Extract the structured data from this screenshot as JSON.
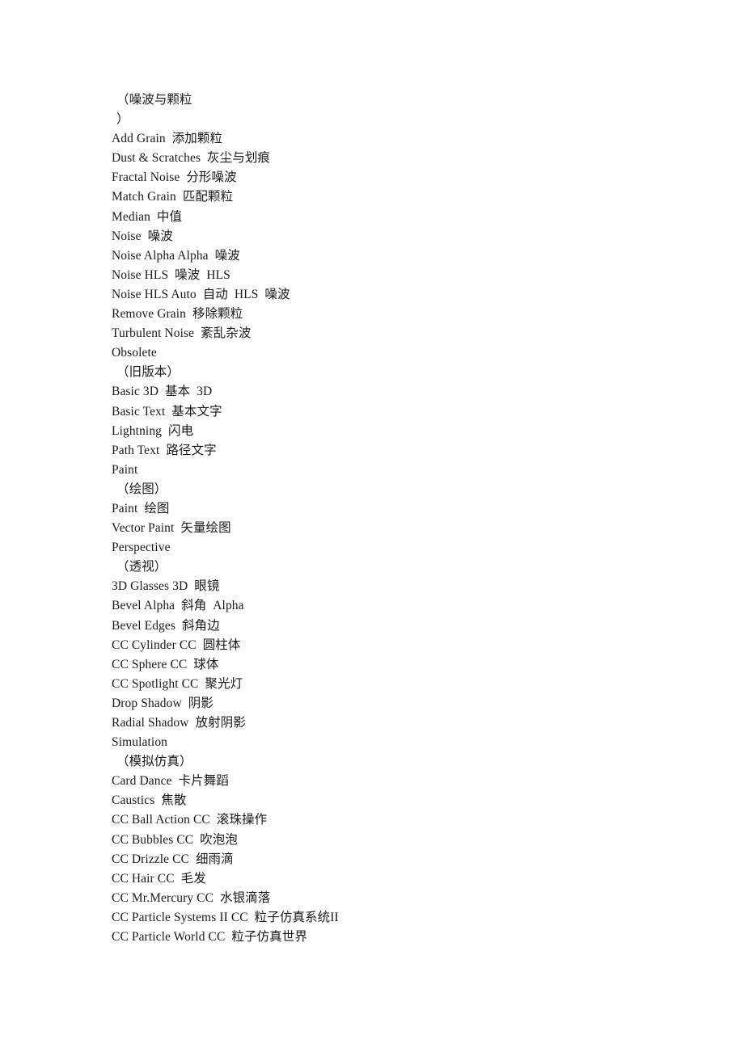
{
  "document": {
    "kind": "bilingual-reference-list",
    "description": "After Effects effect names with Chinese translations",
    "lines": [
      {
        "text": "（噪波与颗粒",
        "style": "indent"
      },
      {
        "text": "）",
        "style": "indent"
      },
      {
        "text": "Add Grain  添加颗粒",
        "style": "entry"
      },
      {
        "text": "Dust & Scratches  灰尘与划痕",
        "style": "entry"
      },
      {
        "text": "Fractal Noise  分形噪波",
        "style": "entry"
      },
      {
        "text": "Match Grain  匹配颗粒",
        "style": "entry"
      },
      {
        "text": "Median  中值",
        "style": "entry"
      },
      {
        "text": "Noise  噪波",
        "style": "entry"
      },
      {
        "text": "Noise Alpha Alpha  噪波",
        "style": "entry"
      },
      {
        "text": "Noise HLS  噪波  HLS",
        "style": "entry"
      },
      {
        "text": "Noise HLS Auto  自动  HLS  噪波",
        "style": "entry"
      },
      {
        "text": "Remove Grain  移除颗粒",
        "style": "entry"
      },
      {
        "text": "Turbulent Noise  紊乱杂波",
        "style": "entry"
      },
      {
        "text": "Obsolete",
        "style": "entry"
      },
      {
        "text": "（旧版本）",
        "style": "indent"
      },
      {
        "text": "Basic 3D  基本  3D",
        "style": "entry"
      },
      {
        "text": "Basic Text  基本文字",
        "style": "entry"
      },
      {
        "text": "Lightning  闪电",
        "style": "entry"
      },
      {
        "text": "Path Text  路径文字",
        "style": "entry"
      },
      {
        "text": "Paint",
        "style": "entry"
      },
      {
        "text": "（绘图）",
        "style": "indent"
      },
      {
        "text": "Paint  绘图",
        "style": "entry"
      },
      {
        "text": "Vector Paint  矢量绘图",
        "style": "entry"
      },
      {
        "text": "Perspective",
        "style": "entry"
      },
      {
        "text": "（透视）",
        "style": "indent"
      },
      {
        "text": "3D Glasses 3D  眼镜",
        "style": "entry"
      },
      {
        "text": "Bevel Alpha  斜角  Alpha",
        "style": "entry"
      },
      {
        "text": "Bevel Edges  斜角边",
        "style": "entry"
      },
      {
        "text": "CC Cylinder CC  圆柱体",
        "style": "entry"
      },
      {
        "text": "CC Sphere CC  球体",
        "style": "entry"
      },
      {
        "text": "CC Spotlight CC  聚光灯",
        "style": "entry"
      },
      {
        "text": "Drop Shadow  阴影",
        "style": "entry"
      },
      {
        "text": "Radial Shadow  放射阴影",
        "style": "entry"
      },
      {
        "text": "Simulation",
        "style": "entry"
      },
      {
        "text": "（模拟仿真）",
        "style": "indent"
      },
      {
        "text": "Card Dance  卡片舞蹈",
        "style": "entry"
      },
      {
        "text": "Caustics  焦散",
        "style": "entry"
      },
      {
        "text": "CC Ball Action CC  滚珠操作",
        "style": "entry"
      },
      {
        "text": "CC Bubbles CC  吹泡泡",
        "style": "entry"
      },
      {
        "text": "CC Drizzle CC  细雨滴",
        "style": "entry"
      },
      {
        "text": "CC Hair CC  毛发",
        "style": "entry"
      },
      {
        "text": "CC Mr.Mercury CC  水银滴落",
        "style": "entry"
      },
      {
        "text": "CC Particle Systems II CC  粒子仿真系统II",
        "style": "entry"
      },
      {
        "text": "CC Particle World CC  粒子仿真世界",
        "style": "entry"
      }
    ]
  }
}
